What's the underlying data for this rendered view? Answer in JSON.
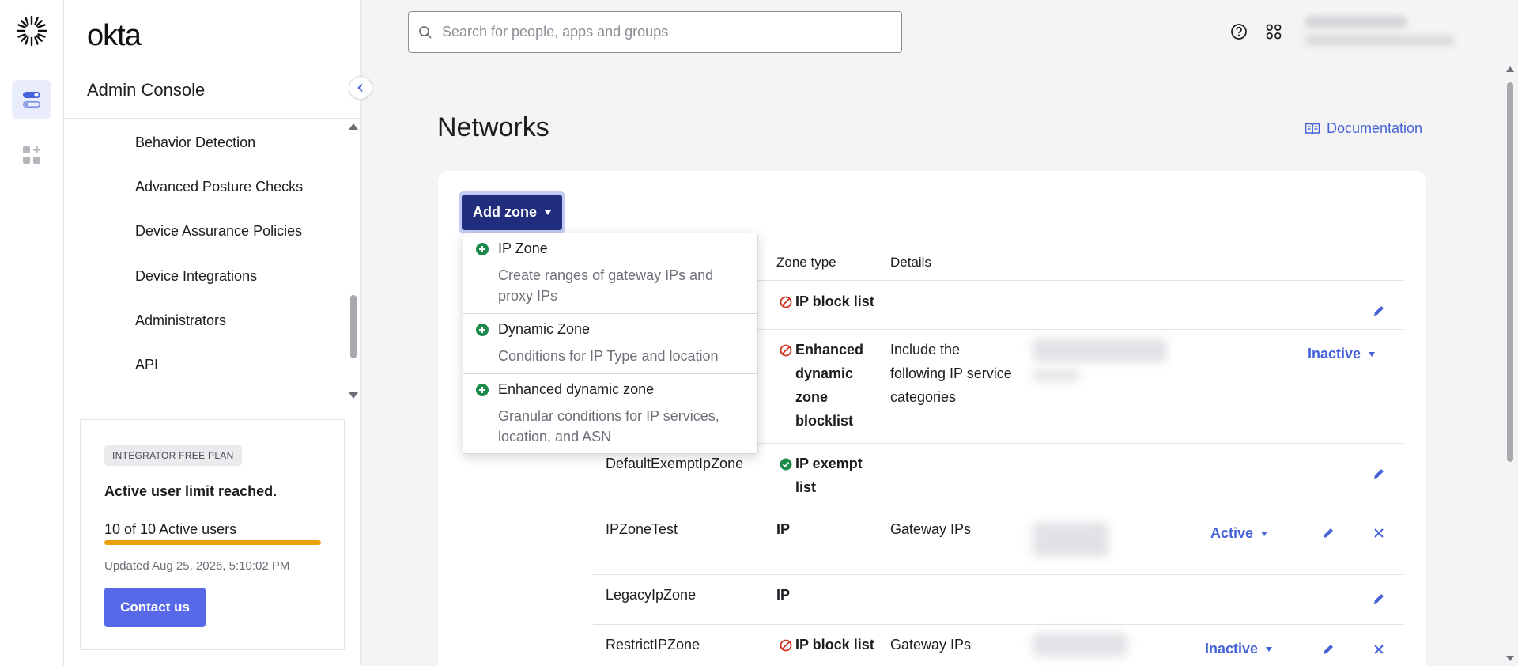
{
  "app": {
    "wordmark": "okta",
    "console_title": "Admin Console"
  },
  "sidebar": {
    "items": [
      {
        "label": "Behavior Detection"
      },
      {
        "label": "Advanced Posture Checks"
      },
      {
        "label": "Device Assurance Policies"
      },
      {
        "label": "Device Integrations"
      },
      {
        "label": "Administrators"
      },
      {
        "label": "API"
      }
    ]
  },
  "plan": {
    "badge": "INTEGRATOR FREE PLAN",
    "heading": "Active user limit reached.",
    "users_text": "10 of 10 Active users",
    "usage_fraction": 1.0,
    "updated": "Updated Aug 25, 2026, 5:10:02 PM",
    "contact_label": "Contact us",
    "bar_color": "#eba10b"
  },
  "search": {
    "placeholder": "Search for people, apps and groups"
  },
  "header_icons": [
    "help-icon",
    "apps-grid-icon"
  ],
  "page": {
    "title": "Networks",
    "doc_link": "Documentation"
  },
  "add_zone": {
    "label": "Add zone"
  },
  "dropdown": {
    "options": [
      {
        "title": "IP Zone",
        "desc": "Create ranges of gateway IPs and proxy IPs"
      },
      {
        "title": "Dynamic Zone",
        "desc": "Conditions for IP Type and location"
      },
      {
        "title": "Enhanced dynamic zone",
        "desc": "Granular conditions for IP services, location, and ASN"
      }
    ]
  },
  "table": {
    "headers": {
      "zone_type": "Zone type",
      "details": "Details"
    },
    "rows": [
      {
        "name": "",
        "type_lines": [
          "IP block list"
        ],
        "type_icon": "block-icon",
        "details": "",
        "status": ""
      },
      {
        "name": "",
        "type_lines": [
          "Enhanced",
          "dynamic",
          "zone",
          "blocklist"
        ],
        "type_icon": "block-icon",
        "details_lines": [
          "Include the",
          "following IP service",
          "categories"
        ],
        "status": "Inactive"
      },
      {
        "name": "DefaultExemptIpZone",
        "type_lines": [
          "IP exempt",
          "list"
        ],
        "type_icon": "check-icon",
        "details": "",
        "status": ""
      },
      {
        "name": "IPZoneTest",
        "type_lines": [
          "IP"
        ],
        "type_icon": "",
        "details": "Gateway IPs",
        "status": "Active"
      },
      {
        "name": "LegacyIpZone",
        "type_lines": [
          "IP"
        ],
        "type_icon": "",
        "details": "",
        "status": ""
      },
      {
        "name": "RestrictIPZone",
        "type_lines": [
          "IP block list"
        ],
        "type_icon": "block-icon",
        "details": "Gateway IPs",
        "status": "Inactive"
      }
    ]
  },
  "colors": {
    "accent": "#4662d8",
    "primary_button": "#1f2d7c",
    "contact_button": "#5769e8",
    "block_red": "#d0331f",
    "exempt_green": "#1b8a4a"
  }
}
